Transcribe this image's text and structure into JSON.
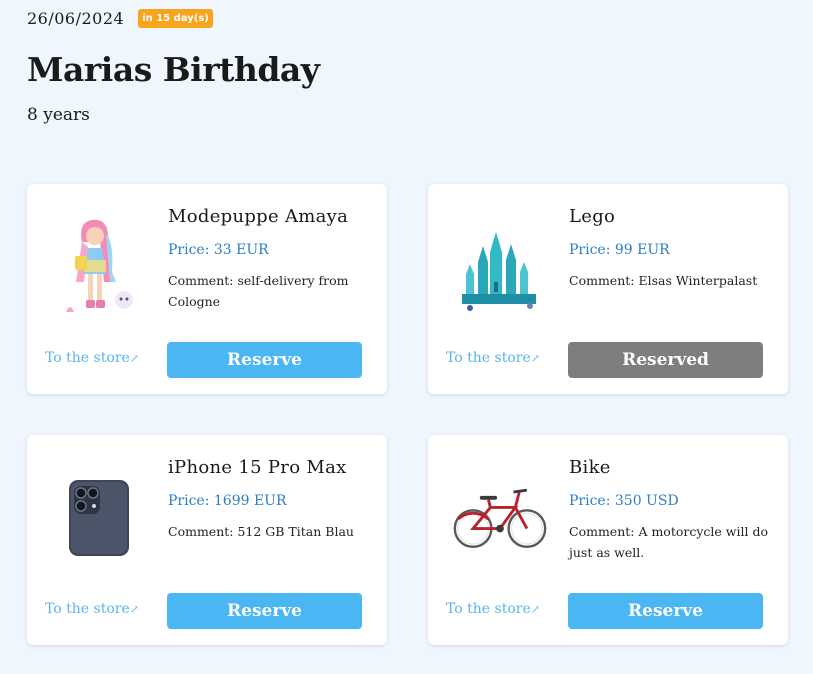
{
  "event": {
    "date": "26/06/2024",
    "countdown": "in 15 day(s)",
    "title": "Marias Birthday",
    "subtitle": "8 years"
  },
  "colors": {
    "background": "#eff6fe",
    "badge": "#f6a51c",
    "price": "#2b7fc4",
    "link": "#59b4ec",
    "reserve_button": "#4ab6f2",
    "reserved_button": "#7e7e7e"
  },
  "gifts": [
    {
      "name": "Modepuppe Amaya",
      "price": "Price: 33 EUR",
      "comment": "Comment: self-delivery from Cologne",
      "link": "To the store",
      "link_icon": "external-link-arrow",
      "button": "Reserve",
      "reserved": false,
      "image": "doll-image"
    },
    {
      "name": "Lego",
      "price": "Price: 99 EUR",
      "comment": "Comment: Elsas Winterpalast",
      "link": "To the store",
      "link_icon": "external-link-arrow",
      "button": "Reserved",
      "reserved": true,
      "image": "lego-castle-image"
    },
    {
      "name": "iPhone 15 Pro Max",
      "price": "Price: 1699 EUR",
      "comment": "Comment: 512 GB Titan Blau",
      "link": "To the store",
      "link_icon": "external-link-arrow",
      "button": "Reserve",
      "reserved": false,
      "image": "iphone-image"
    },
    {
      "name": "Bike",
      "price": "Price: 350 USD",
      "comment": "Comment: A motorcycle will do just as well.",
      "link": "To the store",
      "link_icon": "external-link-arrow",
      "button": "Reserve",
      "reserved": false,
      "image": "bike-image"
    }
  ]
}
